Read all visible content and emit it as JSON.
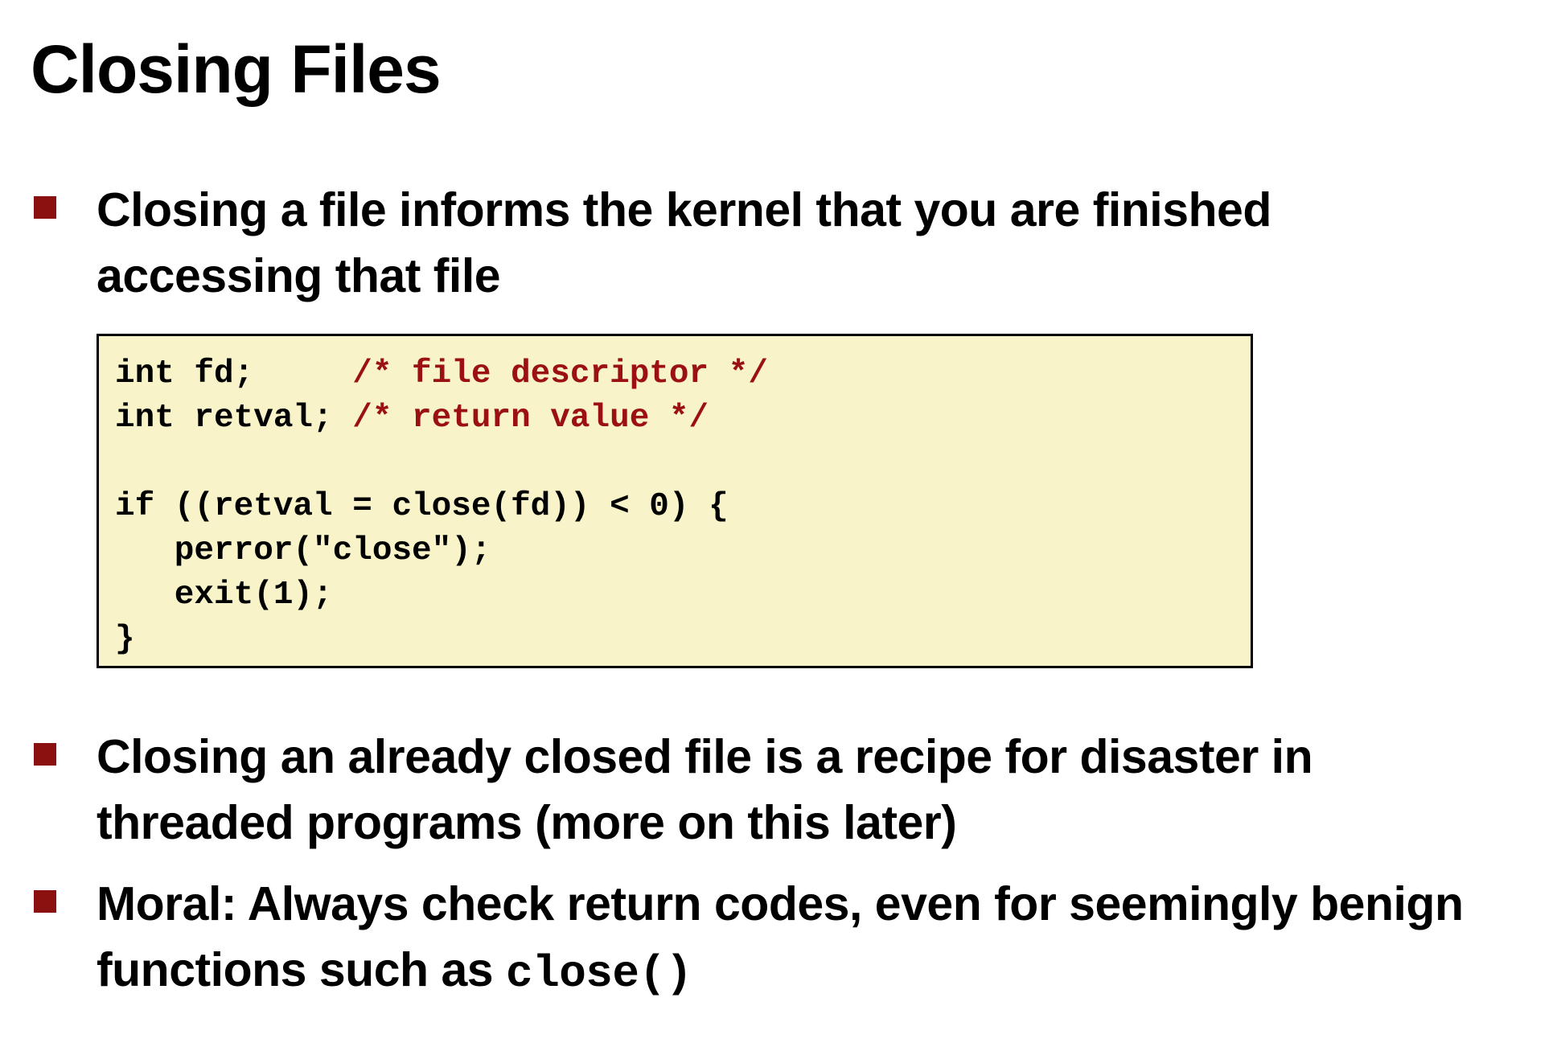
{
  "slide": {
    "title": "Closing Files",
    "bullets": [
      {
        "text": "Closing a file informs the kernel that you are finished accessing that file"
      },
      {
        "text": "Closing an already closed file is a recipe for disaster in threaded programs (more on this later)"
      },
      {
        "text_before_code": "Moral: Always check return codes, even for seemingly benign functions such as ",
        "code": "close()"
      }
    ],
    "code_lines": [
      {
        "code": "int fd;     ",
        "comment": "/* file descriptor */"
      },
      {
        "code": "int retval; ",
        "comment": "/* return value */"
      },
      {
        "code": "",
        "comment": ""
      },
      {
        "code": "if ((retval = close(fd)) < 0) {",
        "comment": ""
      },
      {
        "code": "   perror(\"close\");",
        "comment": ""
      },
      {
        "code": "   exit(1);",
        "comment": ""
      },
      {
        "code": "}",
        "comment": ""
      }
    ],
    "colors": {
      "bullet_marker": "#8b1010",
      "code_background": "#f8f3c8",
      "comment": "#9b1010"
    }
  }
}
